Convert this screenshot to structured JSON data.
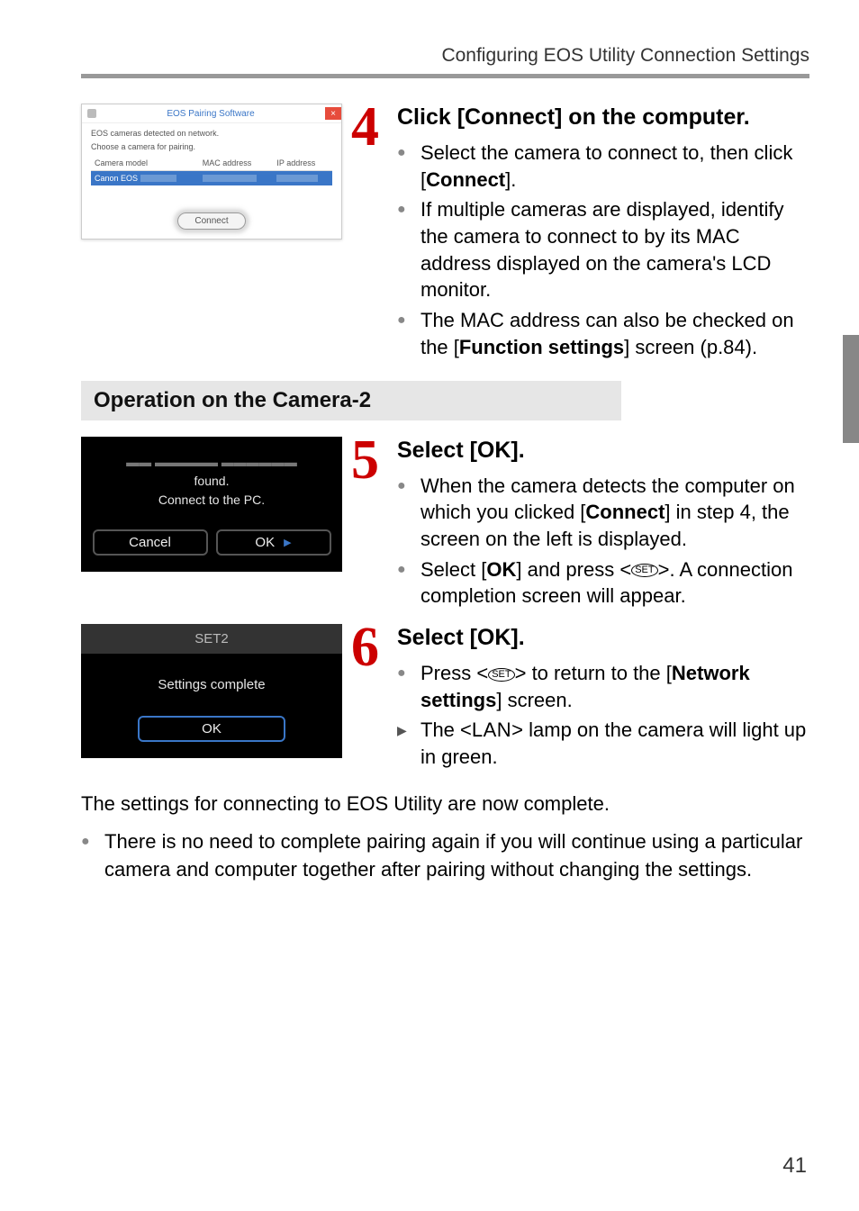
{
  "header": {
    "title": "Configuring EOS Utility Connection Settings"
  },
  "step4": {
    "dialog": {
      "title": "EOS Pairing Software",
      "note1": "EOS cameras detected on network.",
      "note2": "Choose a camera for pairing.",
      "col1": "Camera model",
      "col2": "MAC address",
      "col3": "IP address",
      "row_model": "Canon EOS",
      "connect": "Connect",
      "close": "×"
    },
    "title": "Click [Connect] on the computer.",
    "b1a": "Select the camera to connect to, then click [",
    "b1b": "Connect",
    "b1c": "].",
    "b2": "If multiple cameras are displayed, identify the camera to connect to by its MAC address displayed on the camera's LCD monitor.",
    "b3a": "The MAC address can also be checked on the [",
    "b3b": "Function settings",
    "b3c": "] screen (p.84)."
  },
  "section": {
    "heading": "Operation on the Camera-2"
  },
  "step5": {
    "cam": {
      "found": "found.",
      "connect": "Connect to the PC.",
      "cancel": "Cancel",
      "ok": "OK"
    },
    "title": "Select [OK].",
    "b1a": "When the camera detects the computer on which you clicked [",
    "b1b": "Connect",
    "b1c": "] in step 4, the screen on the left is displayed.",
    "b2a": "Select [",
    "b2b": "OK",
    "b2c": "] and press <",
    "b2d": ">. A connection completion screen will appear."
  },
  "step6": {
    "cam": {
      "tab": "SET2",
      "msg": "Settings complete",
      "ok": "OK"
    },
    "title": "Select [OK].",
    "b1a": "Press <",
    "b1b": "> to return to the [",
    "b1c": "Network settings",
    "b1d": "] screen.",
    "b2a": "The <",
    "b2b": "LAN",
    "b2c": "> lamp on the camera will light up in green."
  },
  "closing": {
    "p1": "The settings for connecting to EOS Utility are now complete.",
    "b1": "There is no need to complete pairing again if you will continue using a particular camera and computer together after pairing without changing the settings."
  },
  "icons": {
    "set": "SET"
  },
  "page": "41"
}
